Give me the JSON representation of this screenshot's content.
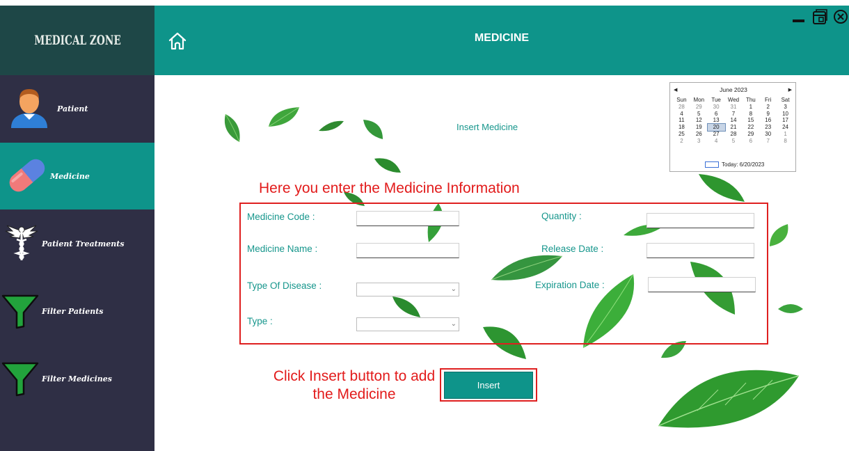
{
  "app": {
    "brand": "MEDICAL ZONE",
    "accent": "#0e948a",
    "sidebar_bg": "#2f2f45",
    "brand_bg": "#1e4747"
  },
  "sidebar": {
    "items": [
      {
        "label": "Patient",
        "icon": "patient-avatar-icon",
        "active": false
      },
      {
        "label": "Medicine",
        "icon": "pill-capsule-icon",
        "active": true
      },
      {
        "label": "Patient Treatments",
        "icon": "caduceus-icon",
        "active": false
      },
      {
        "label": "Filter Patients",
        "icon": "funnel-icon",
        "active": false
      },
      {
        "label": "Filter Medicines",
        "icon": "funnel-icon",
        "active": false
      }
    ]
  },
  "header": {
    "title": "MEDICINE",
    "home_icon": "home-icon",
    "window_controls": [
      "minimize-icon",
      "restore-icon",
      "close-icon"
    ]
  },
  "content": {
    "section_title": "Insert Medicine",
    "annotation_form": "Here you enter the Medicine Information",
    "annotation_button": "Click Insert button to add the Medicine",
    "annotation_color": "#e21b1b",
    "fields": {
      "medicine_code": {
        "label": "Medicine Code  :",
        "value": ""
      },
      "medicine_name": {
        "label": "Medicine Name :",
        "value": ""
      },
      "type_of_disease": {
        "label": "Type Of Disease :",
        "value": ""
      },
      "type": {
        "label": "Type :",
        "value": ""
      },
      "quantity": {
        "label": "Quantity :",
        "value": ""
      },
      "release_date": {
        "label": "Release Date :",
        "value": ""
      },
      "expiration_date": {
        "label": "Expiration Date :",
        "value": ""
      }
    },
    "insert_button": "Insert"
  },
  "calendar": {
    "month": "June 2023",
    "weekdays": [
      "Sun",
      "Mon",
      "Tue",
      "Wed",
      "Thu",
      "Fri",
      "Sat"
    ],
    "weeks": [
      [
        "28",
        "29",
        "30",
        "31",
        "1",
        "2",
        "3"
      ],
      [
        "4",
        "5",
        "6",
        "7",
        "8",
        "9",
        "10"
      ],
      [
        "11",
        "12",
        "13",
        "14",
        "15",
        "16",
        "17"
      ],
      [
        "18",
        "19",
        "20",
        "21",
        "22",
        "23",
        "24"
      ],
      [
        "25",
        "26",
        "27",
        "28",
        "29",
        "30",
        "1"
      ],
      [
        "2",
        "3",
        "4",
        "5",
        "6",
        "7",
        "8"
      ]
    ],
    "selected_day": "20",
    "today_label": "Today: 6/20/2023"
  }
}
